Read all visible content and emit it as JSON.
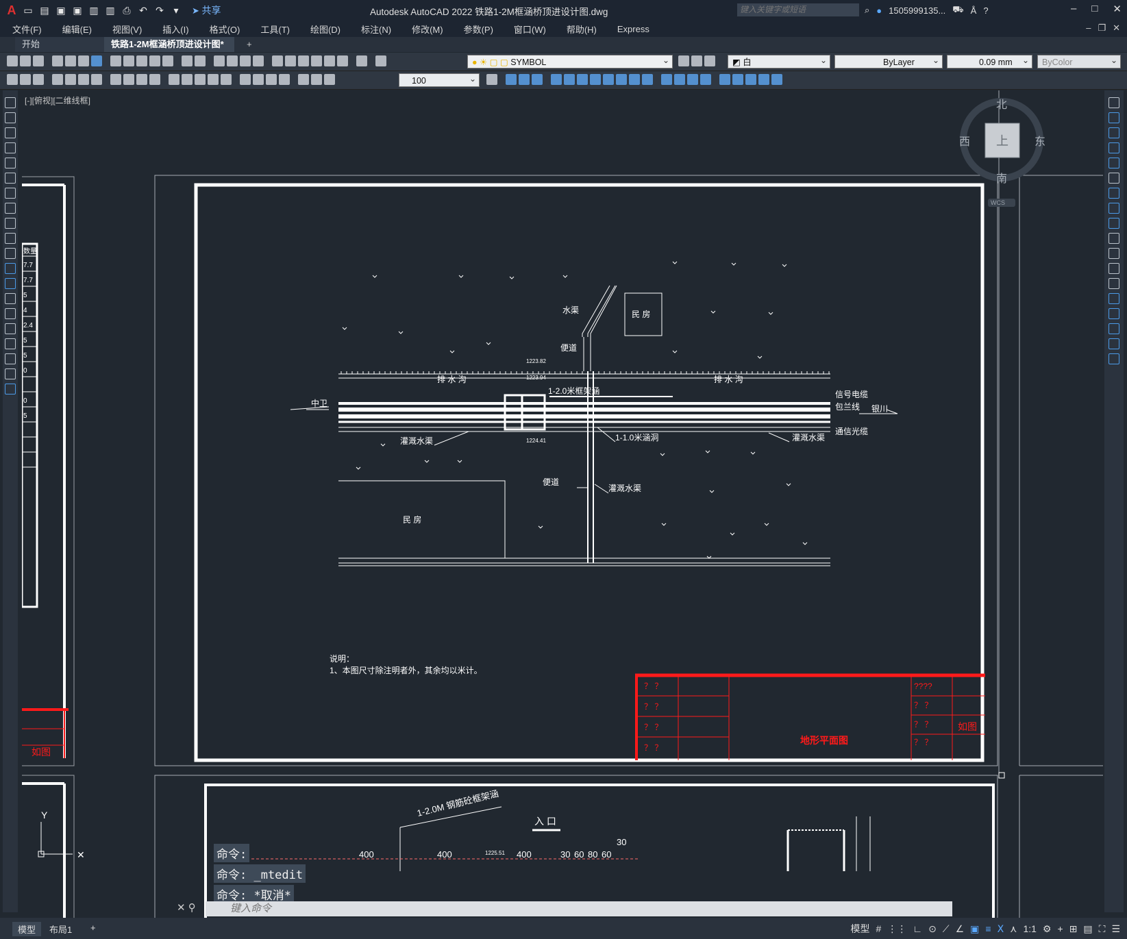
{
  "app": {
    "title": "Autodesk AutoCAD 2022    铁路1-2M框涵桥顶进设计图.dwg",
    "share_label": "共享",
    "search_placeholder": "键入关键字或短语",
    "user": "1505999135...",
    "window_controls": [
      "minimize",
      "maximize",
      "close"
    ]
  },
  "menu": [
    "文件(F)",
    "编辑(E)",
    "视图(V)",
    "插入(I)",
    "格式(O)",
    "工具(T)",
    "绘图(D)",
    "标注(N)",
    "修改(M)",
    "参数(P)",
    "窗口(W)",
    "帮助(H)",
    "Express"
  ],
  "tabs": {
    "start": "开始",
    "document": "铁路1-2M框涵桥顶进设计图*",
    "close": "×",
    "add": "+"
  },
  "toolbar": {
    "layer_name": "SYMBOL",
    "color": "白",
    "linetype": "ByLayer",
    "lineweight": "0.09 mm",
    "plotstyle": "ByColor",
    "scale_value": "100"
  },
  "viewport": {
    "label": "[-][俯视][二维线框]",
    "viewcube": {
      "north": "北",
      "south": "南",
      "east": "东",
      "west": "西",
      "top": "上",
      "wcs": "WCS"
    }
  },
  "drawing": {
    "labels": {
      "min_fang_1": "民  房",
      "min_fang_2": "民   房",
      "shui_qu": "水渠",
      "bian_dao_1": "便道",
      "bian_dao_2": "便道",
      "pai_shui_gou_1": "排 水 沟",
      "pai_shui_gou_2": "排 水 沟",
      "kuang_jia_han": "1-2.0米框架涵",
      "zhong_wei": "中卫",
      "yin_chuan": "银川",
      "xin_hao_dian_lan": "信号电缆",
      "bao_lan_xian": "包兰线",
      "tong_xin_guang_lan": "通信光缆",
      "guan_gai_1": "灌溉水渠",
      "guan_gai_2": "灌溉水渠",
      "guan_gai_3": "灌溉水渠",
      "han_dong": "1-1.0米涵洞",
      "elev_1": "1223.82",
      "elev_2": "1223.94",
      "elev_3": "1224.41",
      "note_title": "说明：",
      "note_1": "1、本图尺寸除注明者外，其余均以米计。",
      "title_block_name": "地形平面图",
      "title_block_scale": "如图",
      "title_block_q4": "????",
      "q": "？ ？",
      "left_ru_tu": "如图",
      "left_header": "数量",
      "left_values": [
        "7.7",
        "7.7",
        "5",
        "4",
        "2.4",
        "5",
        "5",
        "0",
        "0",
        "5"
      ],
      "lower_title": "1-2.0M 钢筋砼框架涵",
      "ru_kou": "入 口",
      "dims": [
        "400",
        "400",
        "400",
        "30",
        "60",
        "80",
        "60",
        "30"
      ],
      "elev_lower": "1225.51"
    }
  },
  "command": {
    "history": [
      "命令:",
      "命令: _mtedit",
      "命令: *取消*"
    ],
    "input_placeholder": "键入命令"
  },
  "statusbar": {
    "model_tab": "模型",
    "layout_tab": "布局1",
    "add": "+",
    "model_label": "模型",
    "scale": "1:1"
  },
  "colors": {
    "background": "#212830",
    "title_block": "#ff1a1a",
    "lines": "#ffffff",
    "accent": "#5aa8ff"
  }
}
